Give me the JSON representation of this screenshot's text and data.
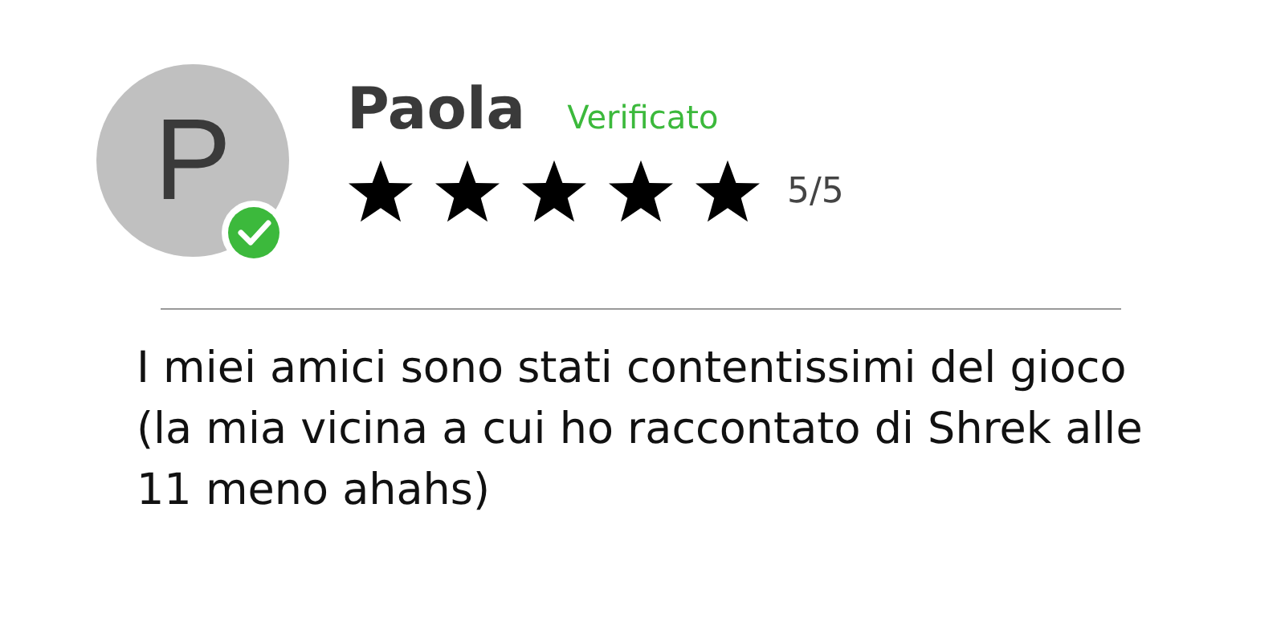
{
  "review": {
    "avatar_initial": "P",
    "verified": true,
    "name": "Paola",
    "verified_label": "Verificato",
    "stars": 5,
    "rating": "5/5",
    "text": "I miei amici sono stati contentissimi del gioco (la mia vicina a cui ho raccontato di Shrek alle 11 meno ahahs)"
  }
}
